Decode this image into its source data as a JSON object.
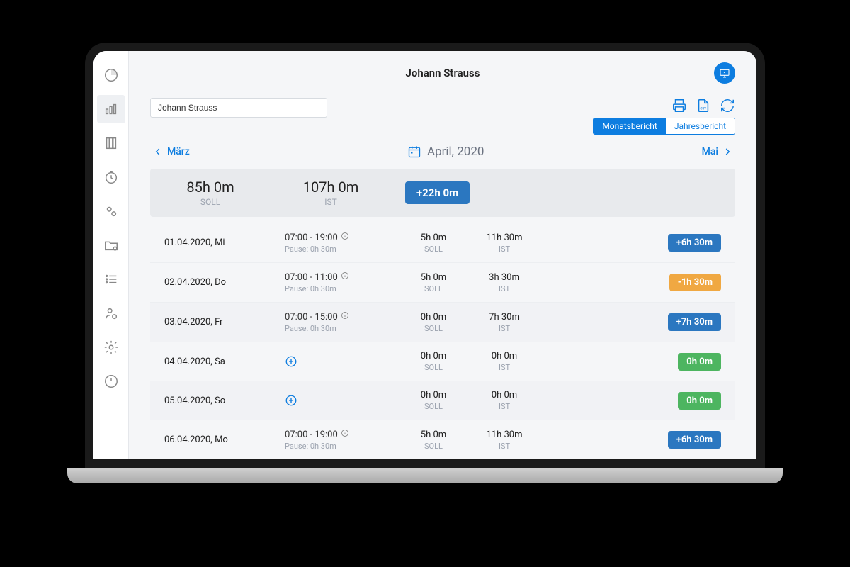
{
  "header": {
    "title": "Johann Strauss"
  },
  "input": {
    "value": "Johann Strauss"
  },
  "reportToggle": {
    "monthly": "Monatsbericht",
    "yearly": "Jahresbericht"
  },
  "monthNav": {
    "prev": "März",
    "current": "April, 2020",
    "next": "Mai"
  },
  "summary": {
    "soll_value": "85h 0m",
    "soll_label": "SOLL",
    "ist_value": "107h 0m",
    "ist_label": "IST",
    "delta": "+22h 0m"
  },
  "labels": {
    "soll": "SOLL",
    "ist": "IST",
    "pause_prefix": "Pause: "
  },
  "rows": [
    {
      "date": "01.04.2020, Mi",
      "range": "07:00 - 19:00",
      "pause": "0h 30m",
      "soll": "5h 0m",
      "ist": "11h 30m",
      "delta": "+6h 30m",
      "color": "blue",
      "shade": false
    },
    {
      "date": "02.04.2020, Do",
      "range": "07:00 - 11:00",
      "pause": "0h 30m",
      "soll": "5h 0m",
      "ist": "3h 30m",
      "delta": "-1h 30m",
      "color": "orange",
      "shade": false
    },
    {
      "date": "03.04.2020, Fr",
      "range": "07:00 - 15:00",
      "pause": "0h 30m",
      "soll": "0h 0m",
      "ist": "7h 30m",
      "delta": "+7h 30m",
      "color": "blue",
      "shade": true
    },
    {
      "date": "04.04.2020, Sa",
      "range": "",
      "pause": "",
      "soll": "0h 0m",
      "ist": "0h 0m",
      "delta": "0h 0m",
      "color": "green",
      "shade": false
    },
    {
      "date": "05.04.2020, So",
      "range": "",
      "pause": "",
      "soll": "0h 0m",
      "ist": "0h 0m",
      "delta": "0h 0m",
      "color": "green",
      "shade": true
    },
    {
      "date": "06.04.2020, Mo",
      "range": "07:00 - 19:00",
      "pause": "0h 30m",
      "soll": "5h 0m",
      "ist": "11h 30m",
      "delta": "+6h 30m",
      "color": "blue",
      "shade": false
    }
  ]
}
